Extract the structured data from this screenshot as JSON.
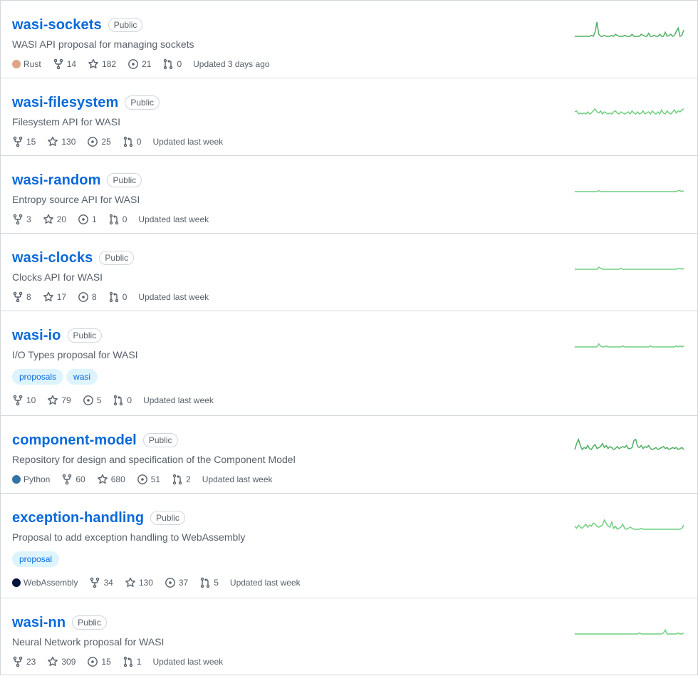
{
  "colors": {
    "link": "#0969da",
    "muted": "#57606a",
    "border": "#d0d7de",
    "spark": "#6fcf7f",
    "rust": "#dea584",
    "python": "#3572A5",
    "webassembly": "#04133b"
  },
  "icons": {
    "fork": "fork-icon",
    "star": "star-icon",
    "issue": "issue-icon",
    "pr": "pull-request-icon"
  },
  "repos": [
    {
      "name": "wasi-sockets",
      "visibility": "Public",
      "description": "WASI API proposal for managing sockets",
      "language": "Rust",
      "language_color": "#dea584",
      "forks": "14",
      "stars": "182",
      "issues": "21",
      "prs": "0",
      "updated": "Updated 3 days ago",
      "topics": [],
      "activity": [
        0,
        0,
        0,
        0,
        0,
        0,
        0,
        0,
        0,
        1,
        0,
        4,
        14,
        2,
        0,
        0,
        1,
        0,
        0,
        0,
        1,
        0,
        2,
        1,
        0,
        0,
        0,
        1,
        0,
        0,
        0,
        2,
        0,
        0,
        0,
        0,
        2,
        1,
        0,
        0,
        3,
        0,
        0,
        1,
        0,
        0,
        2,
        0,
        0,
        4,
        0,
        1,
        2,
        0,
        1,
        5,
        8,
        0,
        1,
        6
      ]
    },
    {
      "name": "wasi-filesystem",
      "visibility": "Public",
      "description": "Filesystem API for WASI",
      "language": "",
      "language_color": "",
      "forks": "15",
      "stars": "130",
      "issues": "25",
      "prs": "0",
      "updated": "Updated last week",
      "topics": [],
      "activity": [
        2,
        3,
        0,
        1,
        0,
        1,
        0,
        2,
        0,
        1,
        3,
        5,
        2,
        1,
        3,
        0,
        2,
        1,
        0,
        1,
        0,
        2,
        3,
        1,
        0,
        2,
        1,
        0,
        1,
        2,
        0,
        3,
        1,
        0,
        2,
        0,
        1,
        3,
        0,
        1,
        2,
        0,
        3,
        1,
        0,
        2,
        0,
        4,
        1,
        0,
        3,
        1,
        0,
        2,
        4,
        1,
        3,
        2,
        4,
        5
      ]
    },
    {
      "name": "wasi-random",
      "visibility": "Public",
      "description": "Entropy source API for WASI",
      "language": "",
      "language_color": "",
      "forks": "3",
      "stars": "20",
      "issues": "1",
      "prs": "0",
      "updated": "Updated last week",
      "topics": [],
      "activity": [
        0,
        0,
        0,
        0,
        0,
        0,
        0,
        0,
        0,
        0,
        0,
        0,
        0,
        1,
        0,
        0,
        0,
        0,
        0,
        0,
        0,
        0,
        0,
        0,
        0,
        0,
        0,
        0,
        0,
        0,
        0,
        0,
        0,
        0,
        0,
        0,
        0,
        0,
        0,
        0,
        0,
        0,
        0,
        0,
        0,
        0,
        0,
        0,
        0,
        0,
        0,
        0,
        0,
        0,
        0,
        0,
        1,
        1,
        0,
        1
      ]
    },
    {
      "name": "wasi-clocks",
      "visibility": "Public",
      "description": "Clocks API for WASI",
      "language": "",
      "language_color": "",
      "forks": "8",
      "stars": "17",
      "issues": "8",
      "prs": "0",
      "updated": "Updated last week",
      "topics": [],
      "activity": [
        0,
        0,
        0,
        0,
        0,
        0,
        0,
        0,
        0,
        0,
        0,
        0,
        0,
        2,
        1,
        0,
        0,
        0,
        0,
        0,
        0,
        0,
        0,
        0,
        0,
        1,
        0,
        0,
        0,
        0,
        0,
        0,
        0,
        0,
        0,
        0,
        0,
        0,
        0,
        0,
        0,
        0,
        0,
        0,
        0,
        0,
        0,
        0,
        0,
        0,
        0,
        0,
        0,
        0,
        0,
        0,
        1,
        1,
        0,
        1
      ]
    },
    {
      "name": "wasi-io",
      "visibility": "Public",
      "description": "I/O Types proposal for WASI",
      "language": "",
      "language_color": "",
      "forks": "10",
      "stars": "79",
      "issues": "5",
      "prs": "0",
      "updated": "Updated last week",
      "topics": [
        "proposals",
        "wasi"
      ],
      "activity": [
        0,
        0,
        0,
        0,
        0,
        0,
        0,
        0,
        0,
        0,
        0,
        0,
        0,
        3,
        1,
        0,
        0,
        1,
        0,
        0,
        0,
        0,
        0,
        0,
        0,
        0,
        1,
        0,
        0,
        0,
        0,
        0,
        0,
        0,
        0,
        0,
        0,
        0,
        0,
        0,
        0,
        1,
        0,
        0,
        0,
        0,
        0,
        0,
        0,
        0,
        0,
        0,
        0,
        0,
        0,
        1,
        0,
        1,
        0,
        1
      ]
    },
    {
      "name": "component-model",
      "visibility": "Public",
      "description": "Repository for design and specification of the Component Model",
      "language": "Python",
      "language_color": "#3572A5",
      "forks": "60",
      "stars": "680",
      "issues": "51",
      "prs": "2",
      "updated": "Updated last week",
      "topics": [],
      "activity": [
        2,
        8,
        12,
        6,
        2,
        4,
        3,
        6,
        3,
        2,
        5,
        7,
        3,
        4,
        5,
        8,
        4,
        6,
        3,
        5,
        4,
        2,
        3,
        5,
        3,
        4,
        5,
        4,
        6,
        3,
        3,
        4,
        11,
        12,
        5,
        4,
        6,
        3,
        5,
        4,
        6,
        3,
        2,
        3,
        4,
        2,
        3,
        4,
        5,
        3,
        4,
        2,
        3,
        4,
        3,
        4,
        2,
        3,
        4,
        2
      ]
    },
    {
      "name": "exception-handling",
      "visibility": "Public",
      "description": "Proposal to add exception handling to WebAssembly",
      "language": "WebAssembly",
      "language_color": "#04133b",
      "forks": "34",
      "stars": "130",
      "issues": "37",
      "prs": "5",
      "updated": "Updated last week",
      "topics": [
        "proposal"
      ],
      "activity": [
        3,
        1,
        4,
        2,
        1,
        3,
        5,
        2,
        4,
        3,
        6,
        5,
        3,
        2,
        3,
        4,
        9,
        6,
        3,
        2,
        7,
        1,
        3,
        0,
        1,
        2,
        5,
        1,
        0,
        1,
        2,
        1,
        0,
        0,
        0,
        0,
        1,
        0,
        0,
        0,
        0,
        0,
        0,
        0,
        0,
        0,
        0,
        0,
        0,
        0,
        0,
        0,
        0,
        0,
        0,
        0,
        0,
        0,
        1,
        4
      ]
    },
    {
      "name": "wasi-nn",
      "visibility": "Public",
      "description": "Neural Network proposal for WASI",
      "language": "",
      "language_color": "",
      "forks": "23",
      "stars": "309",
      "issues": "15",
      "prs": "1",
      "updated": "Updated last week",
      "topics": [],
      "activity": [
        0,
        0,
        0,
        0,
        0,
        0,
        0,
        0,
        0,
        0,
        0,
        0,
        0,
        0,
        0,
        0,
        0,
        0,
        0,
        0,
        0,
        0,
        0,
        0,
        0,
        0,
        0,
        0,
        0,
        0,
        0,
        0,
        0,
        0,
        0,
        1,
        0,
        0,
        0,
        0,
        0,
        0,
        0,
        0,
        0,
        0,
        0,
        0,
        1,
        4,
        0,
        0,
        0,
        0,
        0,
        0,
        1,
        0,
        0,
        1
      ]
    }
  ]
}
